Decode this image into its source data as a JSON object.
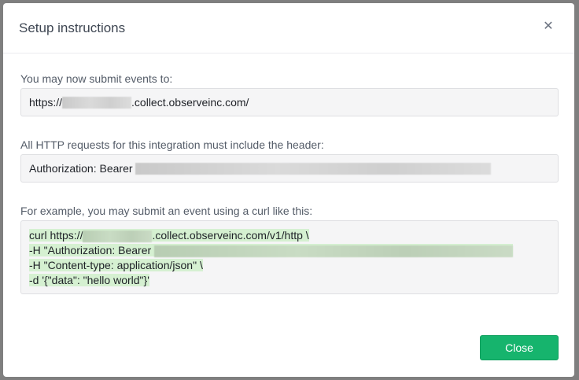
{
  "dialog": {
    "title": "Setup instructions",
    "close_icon": "close-icon"
  },
  "endpoint": {
    "label": "You may now submit events to:",
    "prefix": "https://",
    "suffix": ".collect.observeinc.com/"
  },
  "header": {
    "label": "All HTTP requests for this integration must include the header:",
    "prefix": "Authorization: Bearer"
  },
  "example": {
    "label": "For example, you may submit an event using a curl like this:",
    "line1_prefix": "curl https://",
    "line1_suffix": ".collect.observeinc.com/v1/http \\",
    "line2_prefix": "-H \"Authorization: Bearer",
    "line3": "-H \"Content-type: application/json\" \\",
    "line4": "-d '{\"data\": \"hello world\"}'"
  },
  "footer": {
    "close_label": "Close"
  }
}
